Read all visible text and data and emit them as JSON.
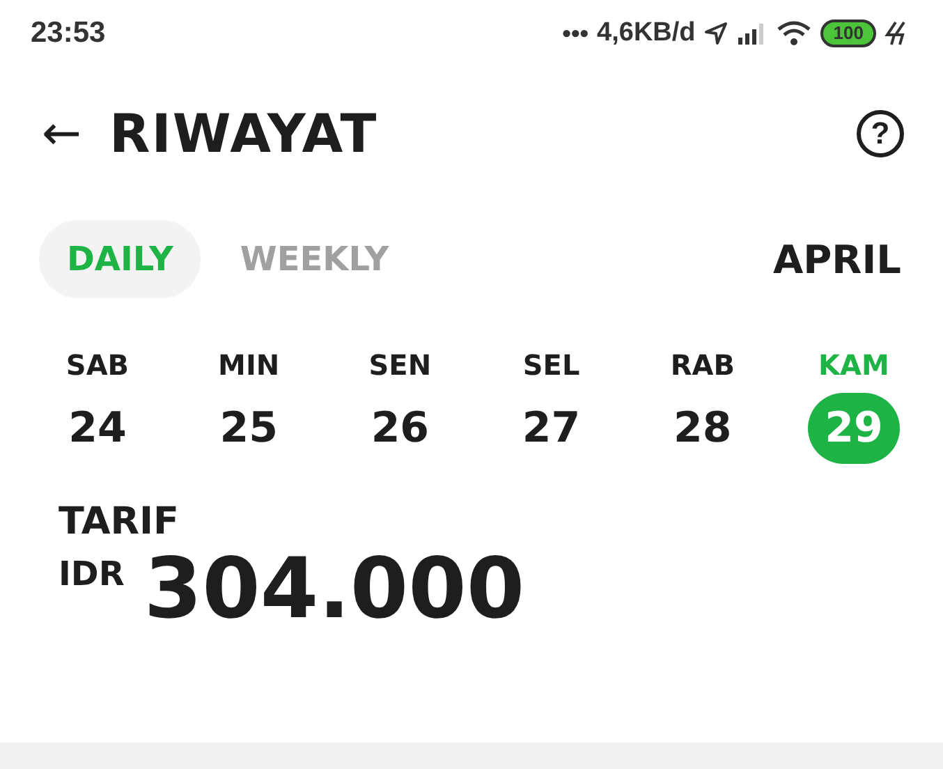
{
  "status_bar": {
    "time": "23:53",
    "dots": "•••",
    "speed": "4,6KB/d",
    "battery": "100"
  },
  "header": {
    "back": "←",
    "title": "RIWAYAT",
    "help": "?"
  },
  "tabs": [
    {
      "label": "DAILY",
      "selected": true
    },
    {
      "label": "WEEKLY",
      "selected": false
    }
  ],
  "month": "APRIL",
  "days": [
    {
      "weekday": "SAB",
      "date": "24",
      "selected": false
    },
    {
      "weekday": "MIN",
      "date": "25",
      "selected": false
    },
    {
      "weekday": "SEN",
      "date": "26",
      "selected": false
    },
    {
      "weekday": "SEL",
      "date": "27",
      "selected": false
    },
    {
      "weekday": "RAB",
      "date": "28",
      "selected": false
    },
    {
      "weekday": "KAM",
      "date": "29",
      "selected": true
    }
  ],
  "tarif": {
    "label": "TARIF",
    "currency": "IDR",
    "amount": "304.000"
  }
}
